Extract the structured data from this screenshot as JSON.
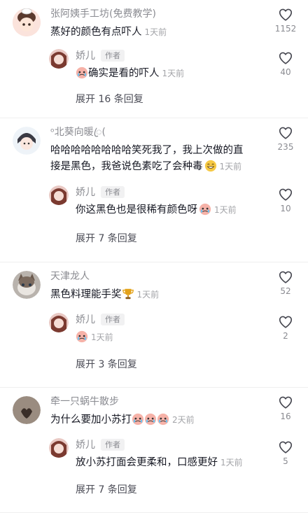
{
  "threads": [
    {
      "user": "张阿姨手工坊(免费教学)",
      "text": "蒸好的颜色有点吓人",
      "time": "1天前",
      "likes": "1152",
      "reply": {
        "user": "娇儿",
        "tag": "作者",
        "text": "确实是看的吓人",
        "time": "1天前",
        "likes": "40"
      },
      "expand": "展开 16 条回复"
    },
    {
      "user": "ᵒ北葵向暖ꦿ(",
      "text_line1": "哈哈哈哈哈哈哈哈笑死我了，我上次做的直",
      "text_line2": "接是黑色，我爸说色素吃了会种毒",
      "time": "1天前",
      "likes": "235",
      "reply": {
        "user": "娇儿",
        "tag": "作者",
        "text": "你这黑色也是很稀有颜色呀",
        "time": "1天前",
        "likes": "10"
      },
      "expand": "展开 7 条回复"
    },
    {
      "user": "天津龙人",
      "text": "黑色料理能手奖",
      "time": "1天前",
      "likes": "52",
      "reply": {
        "user": "娇儿",
        "tag": "作者",
        "text": "",
        "time": "1天前",
        "likes": "2"
      },
      "expand": "展开 3 条回复"
    },
    {
      "user": "牵一只蜗牛散步",
      "text": "为什么要加小苏打",
      "time": "2天前",
      "likes": "16",
      "reply": {
        "user": "娇儿",
        "tag": "作者",
        "text": "放小苏打面会更柔和，口感更好",
        "time": "1天前",
        "likes": "5"
      },
      "expand": "展开 7 条回复"
    }
  ],
  "colors": {
    "name": "#8a8b91",
    "text": "#161823",
    "time": "#a3a4a8"
  }
}
